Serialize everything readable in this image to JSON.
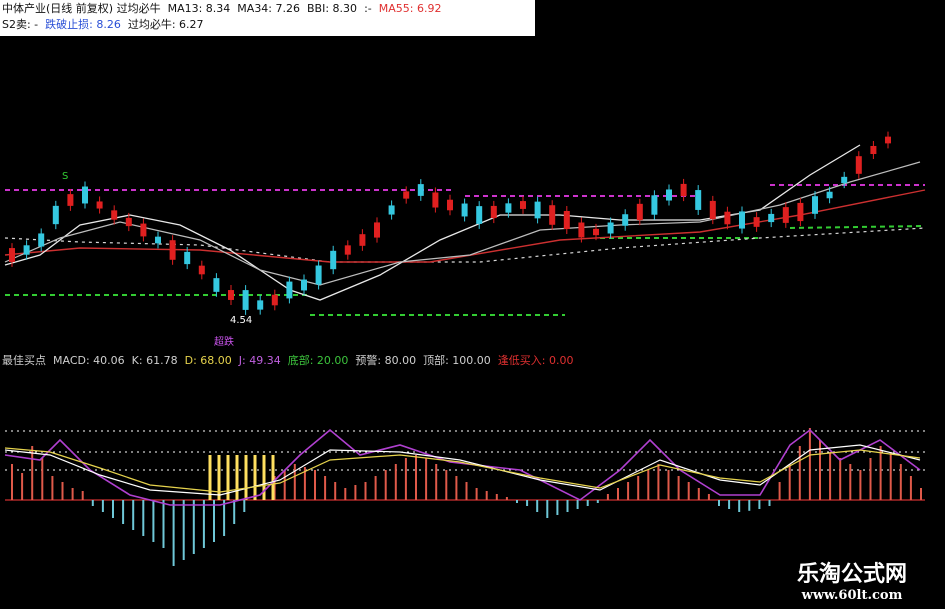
{
  "header": {
    "line1": [
      {
        "text": "中体产业(日线 前复权) 过均必牛",
        "color": "#111111"
      },
      {
        "text": "MA13: 8.34",
        "color": "#111111"
      },
      {
        "text": "MA34: 7.26",
        "color": "#111111"
      },
      {
        "text": "BBI: 8.30",
        "color": "#111111"
      },
      {
        "text": ":-",
        "color": "#111111"
      },
      {
        "text": "MA55: 6.92",
        "color": "#e03030"
      }
    ],
    "line2": [
      {
        "text": "S2卖: -",
        "color": "#111111"
      },
      {
        "text": "跌破止损: 8.26",
        "color": "#2a4fd6"
      },
      {
        "text": "过均必牛: 6.27",
        "color": "#111111"
      }
    ]
  },
  "indicator_bar": [
    {
      "text": "最佳买点",
      "color": "#cfcfcf"
    },
    {
      "text": "MACD: 40.06",
      "color": "#cfcfcf"
    },
    {
      "text": "K: 61.78",
      "color": "#cfcfcf"
    },
    {
      "text": "D: 68.00",
      "color": "#e6d34d"
    },
    {
      "text": "J: 49.34",
      "color": "#c060e0"
    },
    {
      "text": "底部: 20.00",
      "color": "#3cc33c"
    },
    {
      "text": "预警: 80.00",
      "color": "#cfcfcf"
    },
    {
      "text": "顶部: 100.00",
      "color": "#cfcfcf"
    },
    {
      "text": "逢低买入: 0.00",
      "color": "#e03030"
    }
  ],
  "annotations": {
    "s_label": "S",
    "low_value": "4.54",
    "chao_die": "超跌"
  },
  "watermark": {
    "brand": "乐淘公式网",
    "url": "www.60lt.com"
  },
  "colors": {
    "up": "#e02020",
    "down": "#35c8e0",
    "macd_up": "#e05a4a",
    "macd_down": "#6fc8d8",
    "j_line": "#b040d0",
    "k_line": "#ffffff",
    "d_line": "#e6d34d",
    "dot_line": "#ffffff",
    "magenta": "#cc33cc",
    "green": "#33cc33",
    "highlight": "#ffe060"
  }
}
